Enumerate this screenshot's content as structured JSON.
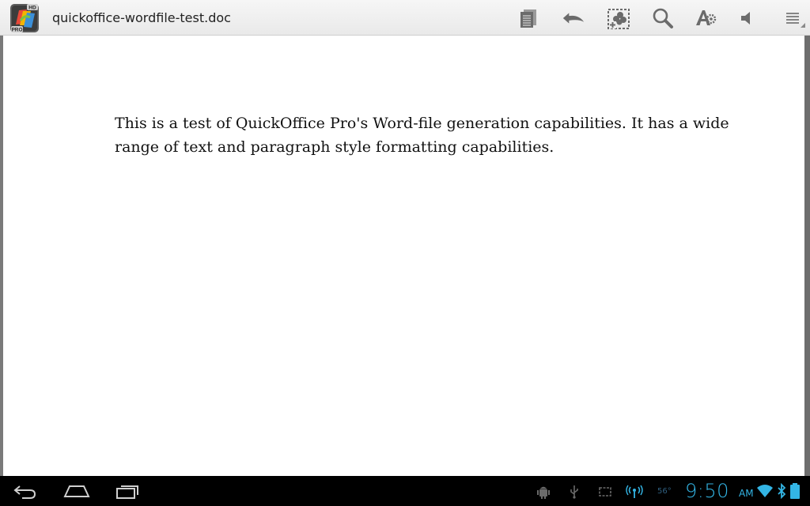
{
  "actionbar": {
    "title": "quickoffice-wordfile-test.doc",
    "app_icon": "quickoffice-pro-hd-icon",
    "app_icon_badge_top": "HD",
    "app_icon_badge_bottom": "PRO",
    "tools": [
      "pages-icon",
      "undo-icon",
      "insert-image-icon",
      "search-icon",
      "font-format-icon",
      "speaker-icon",
      "overflow-menu-icon"
    ]
  },
  "document": {
    "paragraph": "This is a test of QuickOffice Pro's Word-file generation capabilities. It has a wide range of text and paragraph style formatting capabilities."
  },
  "sysbar": {
    "nav": [
      "back-icon",
      "home-icon",
      "recent-apps-icon"
    ],
    "status_icons": [
      "android-debug-icon",
      "usb-icon",
      "screenshot-icon",
      "hotspot-icon",
      "wifi-icon",
      "bluetooth-icon",
      "battery-icon"
    ],
    "temperature": "56°",
    "time": "9:50",
    "ampm": "AM"
  },
  "colors": {
    "clock": "#33b5e5",
    "actionbar_bg": "#efefef",
    "page_bg": "#ffffff"
  }
}
